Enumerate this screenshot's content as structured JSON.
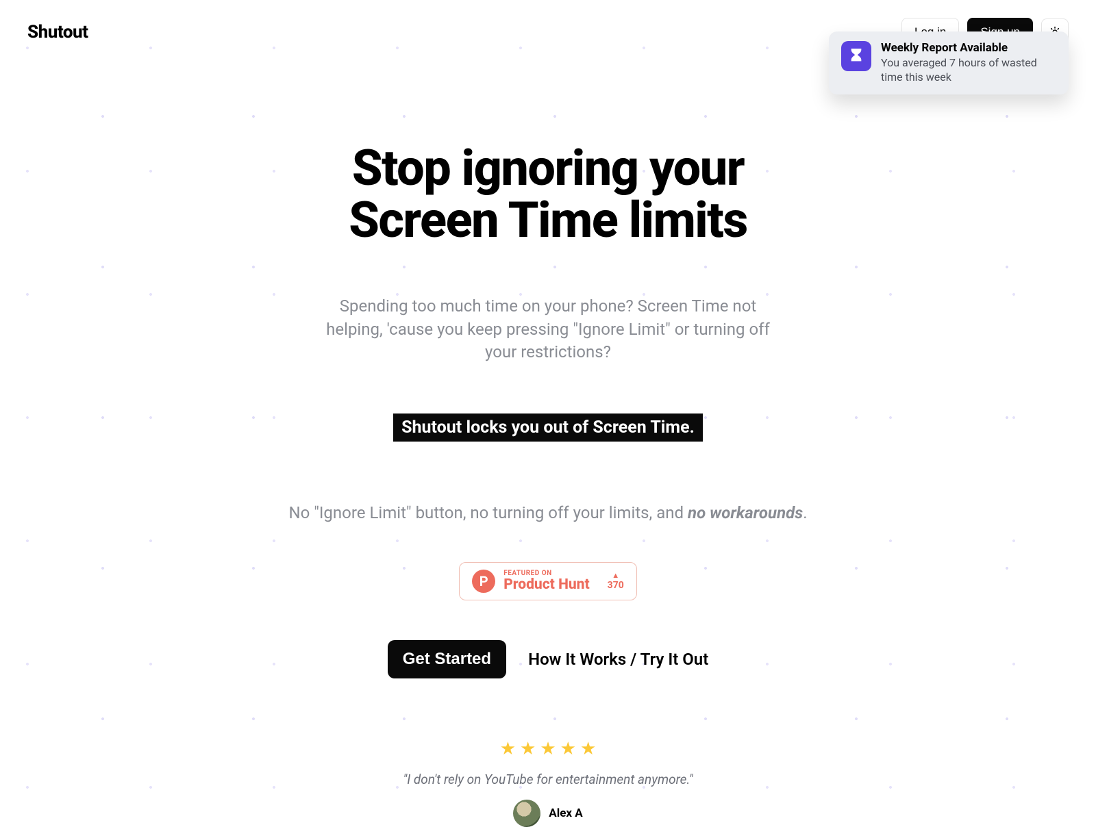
{
  "header": {
    "logo": "Shutout",
    "login": "Log in",
    "signup": "Sign up"
  },
  "toast": {
    "title": "Weekly Report Available",
    "body": "You averaged 7 hours of wasted time this week"
  },
  "hero": {
    "title_line1": "Stop ignoring your",
    "title_line2": "Screen Time limits",
    "sub": "Spending too much time on your phone? Screen Time not helping, 'cause you keep pressing \"Ignore Limit\" or turning off your restrictions?",
    "lockbar": "Shutout locks you out of Screen Time.",
    "no_ignore_prefix": "No \"Ignore Limit\" button, no turning off your limits, and ",
    "no_ignore_em": "no workarounds",
    "no_ignore_suffix": "."
  },
  "producthunt": {
    "featured": "FEATURED ON",
    "name": "Product Hunt",
    "votes": "370"
  },
  "cta": {
    "primary": "Get Started",
    "secondary": "How It Works / Try It Out"
  },
  "review": {
    "stars": 5,
    "text": "\"I don't rely on YouTube for entertainment anymore.\"",
    "reviewer": "Alex A"
  }
}
